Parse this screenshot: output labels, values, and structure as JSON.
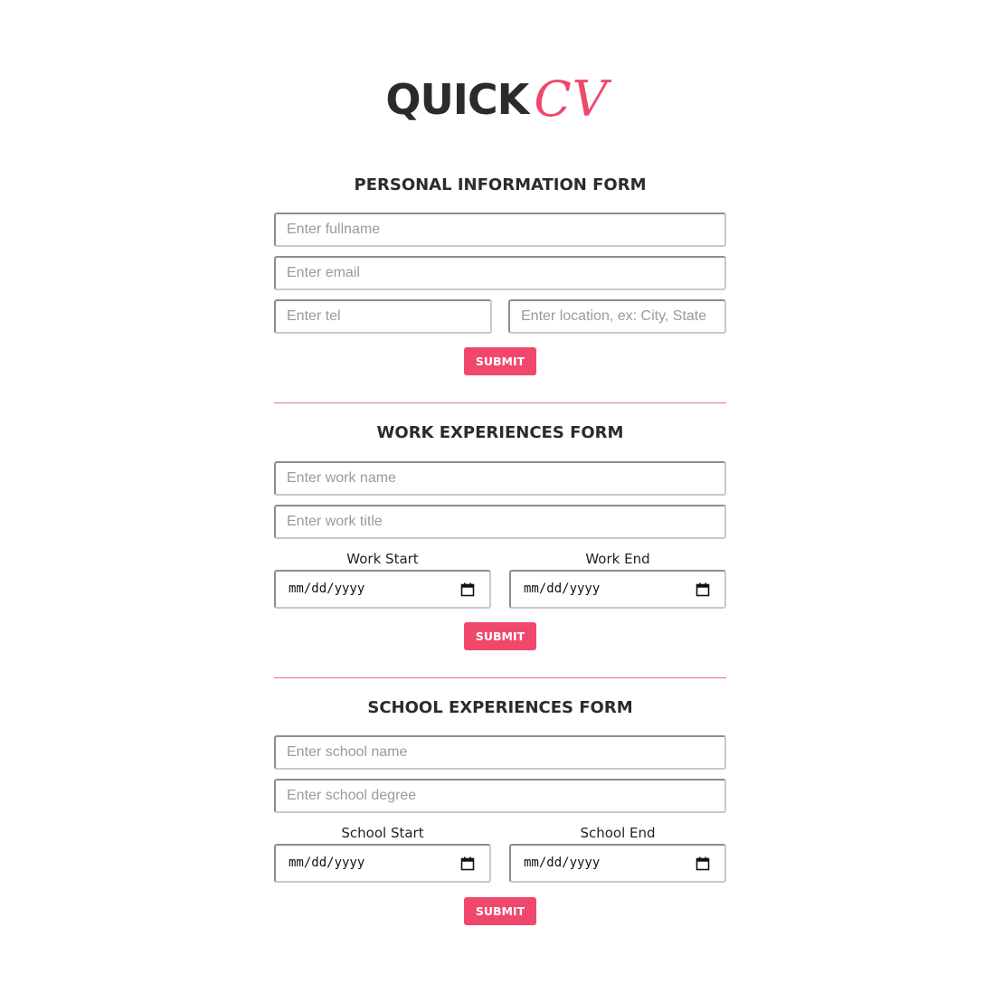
{
  "logo": {
    "quick": "QUICK",
    "cv": "CV"
  },
  "colors": {
    "accent": "#f0476d",
    "text": "#2b2b2b",
    "divider": "#e2738b"
  },
  "personal": {
    "title": "PERSONAL INFORMATION FORM",
    "fullname_placeholder": "Enter fullname",
    "email_placeholder": "Enter email",
    "tel_placeholder": "Enter tel",
    "location_placeholder": "Enter location, ex: City, State",
    "submit_label": "SUBMIT"
  },
  "work": {
    "title": "WORK EXPERIENCES FORM",
    "name_placeholder": "Enter work name",
    "title_placeholder": "Enter work title",
    "start_label": "Work Start",
    "end_label": "Work End",
    "date_format": "mm/dd/yyyy",
    "submit_label": "SUBMIT"
  },
  "school": {
    "title": "SCHOOL EXPERIENCES FORM",
    "name_placeholder": "Enter school name",
    "degree_placeholder": "Enter school degree",
    "start_label": "School Start",
    "end_label": "School End",
    "date_format": "mm/dd/yyyy",
    "submit_label": "SUBMIT"
  },
  "icons": {
    "calendar": "calendar-icon"
  }
}
